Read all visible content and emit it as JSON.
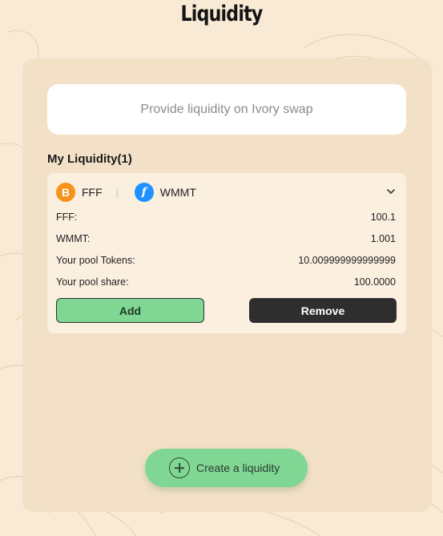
{
  "page": {
    "title": "Liquidity"
  },
  "banner": {
    "text": "Provide liquidity on Ivory swap"
  },
  "my_liquidity": {
    "title": "My Liquidity(1)",
    "positions": [
      {
        "token_a": {
          "symbol": "FFF",
          "icon": "bitcoin-icon",
          "icon_glyph": "B",
          "color": "#f7931a"
        },
        "token_b": {
          "symbol": "WMMT",
          "icon": "wmmt-icon",
          "icon_glyph": "f",
          "color": "#1e90ff"
        },
        "separator": "|",
        "rows": [
          {
            "label": "FFF:",
            "value": "100.1"
          },
          {
            "label": "WMMT:",
            "value": "1.001"
          },
          {
            "label": "Your pool Tokens:",
            "value": "10.009999999999999"
          },
          {
            "label": "Your pool share:",
            "value": "100.0000"
          }
        ],
        "add_label": "Add",
        "remove_label": "Remove"
      }
    ]
  },
  "create": {
    "label": "Create a liquidity",
    "icon": "plus-circle-icon"
  },
  "colors": {
    "background": "#f9ead6",
    "card": "#f3e1c7",
    "accent_green": "#7fd793",
    "dark_button": "#2e2e2e"
  }
}
